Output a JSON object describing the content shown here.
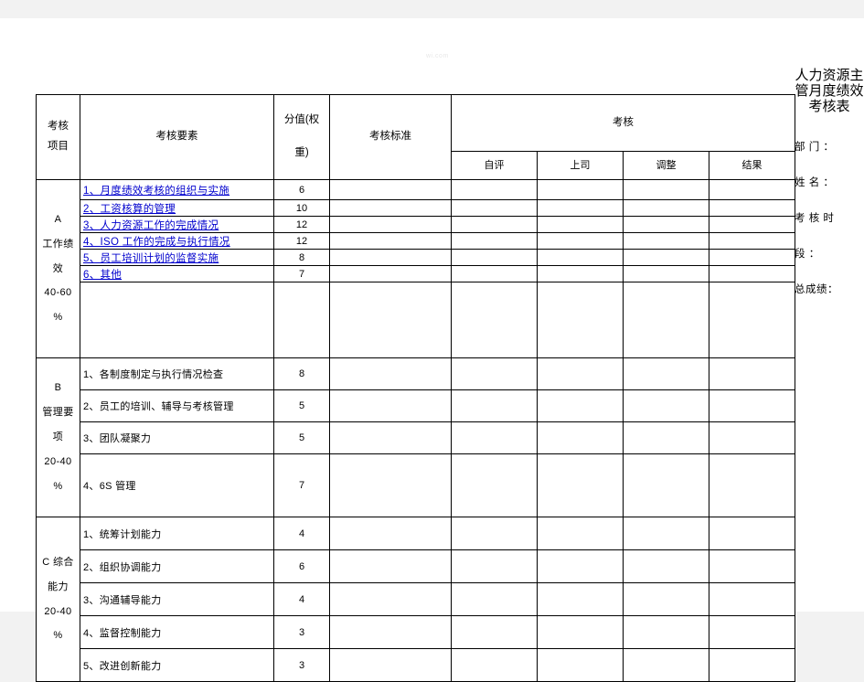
{
  "document": {
    "title_vertical": "人力资源主管月度绩效考核表",
    "fields": [
      {
        "label": "部 门 ：",
        "value": ""
      },
      {
        "label": "姓 名 ：",
        "value": ""
      },
      {
        "label": "考 核 时",
        "value": ""
      },
      {
        "label": "段      ：",
        "value": ""
      },
      {
        "label": "总成绩：",
        "value": ""
      }
    ],
    "watermark": "wi.com"
  },
  "table": {
    "headers": {
      "category": [
        "考核",
        "项目"
      ],
      "element": "考核要素",
      "score": [
        "分值(权",
        "重)"
      ],
      "standard": "考核标准",
      "appraisal_group": "考核",
      "appraisal_cols": [
        "自评",
        "上司",
        "调整",
        "结果"
      ]
    },
    "sections": [
      {
        "id": "A",
        "category_lines": [
          "A",
          "工作绩",
          "效",
          "40-60",
          "%"
        ],
        "style": "link",
        "rows": [
          {
            "element": "1、月度绩效考核的组织与实施",
            "score": "6",
            "standard": "",
            "self": "",
            "boss": "",
            "adjust": "",
            "result": ""
          },
          {
            "element": "2、工资核算的管理",
            "score": "10",
            "standard": "",
            "self": "",
            "boss": "",
            "adjust": "",
            "result": ""
          },
          {
            "element": "3、人力资源工作的完成情况",
            "score": "12",
            "standard": "",
            "self": "",
            "boss": "",
            "adjust": "",
            "result": ""
          },
          {
            "element": "4、ISO 工作的完成与执行情况",
            "score": "12",
            "standard": "",
            "self": "",
            "boss": "",
            "adjust": "",
            "result": ""
          },
          {
            "element": "5、员工培训计划的监督实施",
            "score": "8",
            "standard": "",
            "self": "",
            "boss": "",
            "adjust": "",
            "result": ""
          },
          {
            "element": "6、其他",
            "score": "7",
            "standard": "",
            "self": "",
            "boss": "",
            "adjust": "",
            "result": ""
          }
        ]
      },
      {
        "id": "B",
        "category_lines": [
          "B",
          "管理要",
          "项",
          "20-40",
          "%"
        ],
        "style": "plain",
        "rows": [
          {
            "element": "1、各制度制定与执行情况检查",
            "score": "8",
            "standard": "",
            "self": "",
            "boss": "",
            "adjust": "",
            "result": ""
          },
          {
            "element": "2、员工的培训、辅导与考核管理",
            "score": "5",
            "standard": "",
            "self": "",
            "boss": "",
            "adjust": "",
            "result": ""
          },
          {
            "element": "3、团队凝聚力",
            "score": "5",
            "standard": "",
            "self": "",
            "boss": "",
            "adjust": "",
            "result": ""
          },
          {
            "element": "4、6S 管理",
            "score": "7",
            "standard": "",
            "self": "",
            "boss": "",
            "adjust": "",
            "result": ""
          }
        ]
      },
      {
        "id": "C",
        "category_lines": [
          "C 综合",
          "能力",
          "20-40",
          "%"
        ],
        "style": "plain",
        "rows": [
          {
            "element": "1、统筹计划能力",
            "score": "4",
            "standard": "",
            "self": "",
            "boss": "",
            "adjust": "",
            "result": ""
          },
          {
            "element": "2、组织协调能力",
            "score": "6",
            "standard": "",
            "self": "",
            "boss": "",
            "adjust": "",
            "result": ""
          },
          {
            "element": "3、沟通辅导能力",
            "score": "4",
            "standard": "",
            "self": "",
            "boss": "",
            "adjust": "",
            "result": ""
          },
          {
            "element": "4、监督控制能力",
            "score": "3",
            "standard": "",
            "self": "",
            "boss": "",
            "adjust": "",
            "result": ""
          },
          {
            "element": "5、改进创新能力",
            "score": "3",
            "standard": "",
            "self": "",
            "boss": "",
            "adjust": "",
            "result": ""
          }
        ]
      }
    ]
  }
}
